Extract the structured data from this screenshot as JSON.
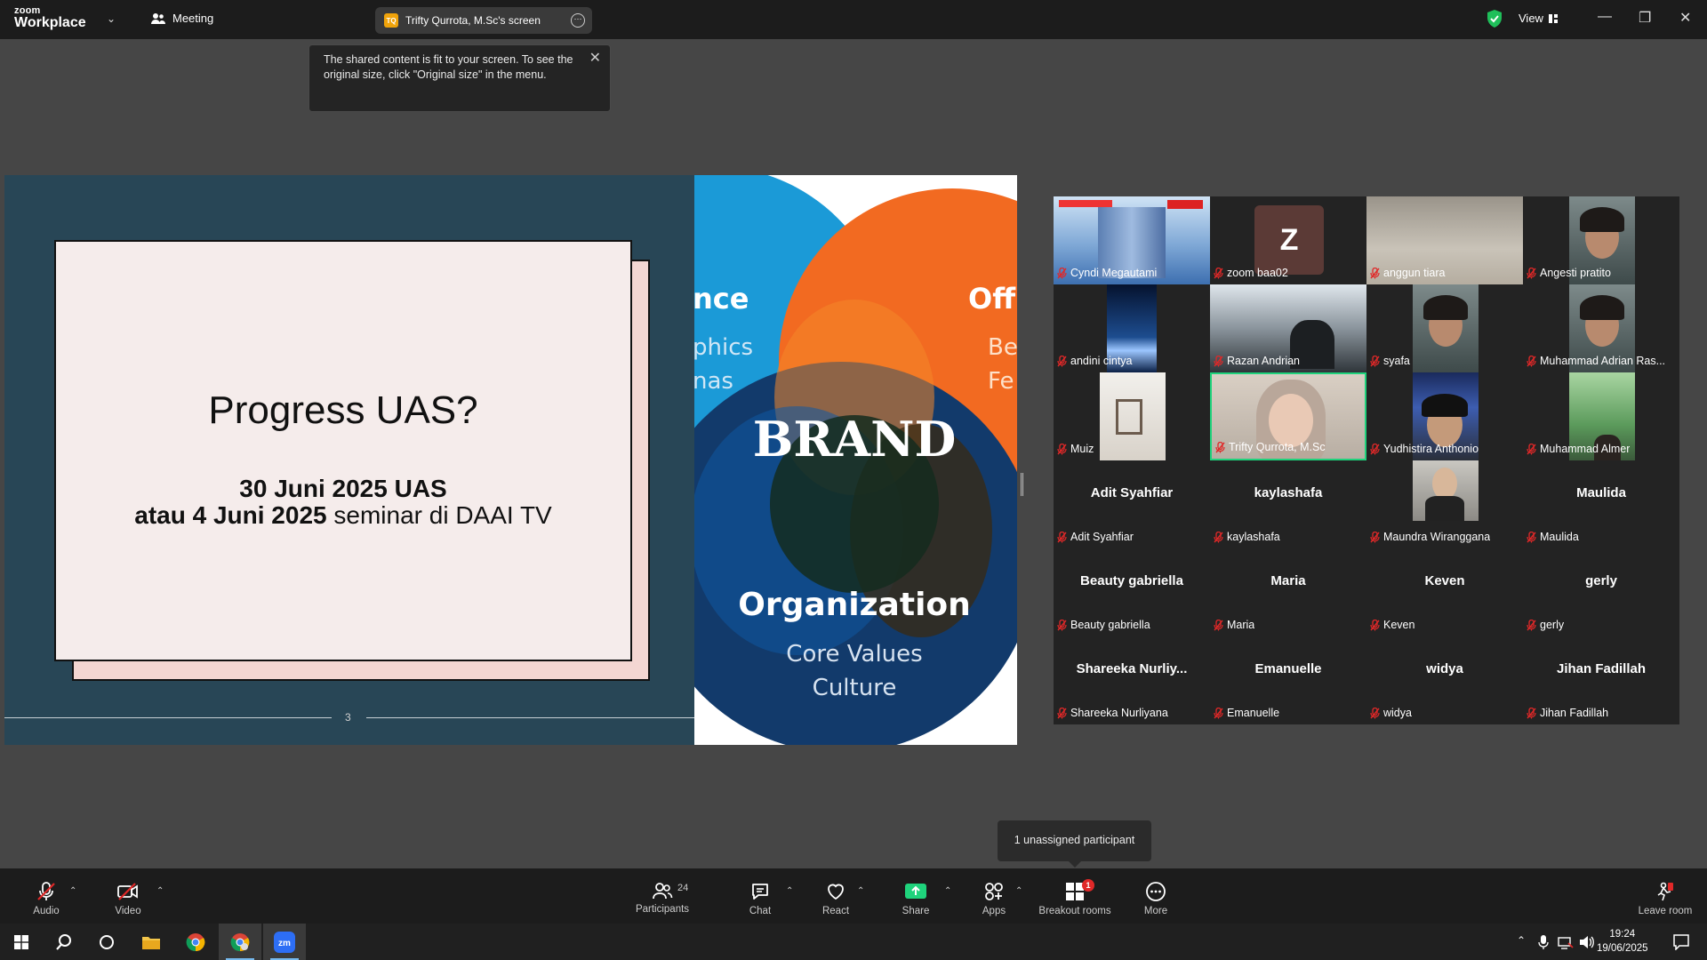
{
  "titlebar": {
    "logo_top": "zoom",
    "logo_bottom": "Workplace",
    "meeting_label": "Meeting",
    "share_tab_badge": "TQ",
    "share_tab_label": "Trifty Qurrota, M.Sc's screen",
    "view_label": "View"
  },
  "fit_tooltip": {
    "text": "The shared content is fit to your screen. To see the original size, click \"Original size\" in the menu."
  },
  "slide": {
    "title": "Progress UAS?",
    "line1": "30 Juni 2025 UAS",
    "line2_bold": "atau 4 Juni 2025",
    "line2_rest": " seminar di DAAI TV",
    "page_number": "3"
  },
  "brand_slide": {
    "left_word": "nce",
    "left_sub1": "phics",
    "left_sub2": "nas",
    "right_word": "Off",
    "right_sub1": "Be",
    "right_sub2": "Fe",
    "center": "BRAND",
    "bottom_title": "Organization",
    "bottom_sub1": "Core Values",
    "bottom_sub2": "Culture",
    "colors": {
      "blue": "#1a9ad6",
      "orange": "#f26a21",
      "navy": "#123a6b",
      "dark_blue": "#0e4f8c"
    }
  },
  "gallery": {
    "tiles": [
      {
        "label": "Cyndi Megautami",
        "center": "",
        "video": "building"
      },
      {
        "label": "zoom baa02",
        "center": "",
        "video": "avatar-z"
      },
      {
        "label": "anggun tiara",
        "center": "",
        "video": "blur"
      },
      {
        "label": "Angesti pratito",
        "center": "",
        "video": "face"
      },
      {
        "label": "andini cintya",
        "center": "",
        "video": "earth"
      },
      {
        "label": "Razan Andrian",
        "center": "",
        "video": "room"
      },
      {
        "label": "syafa",
        "center": "",
        "video": "face"
      },
      {
        "label": "Muhammad Adrian Ras...",
        "center": "",
        "video": "face"
      },
      {
        "label": "Muiz",
        "center": "",
        "video": "room-light"
      },
      {
        "label": "Trifty Qurrota, M.Sc",
        "center": "",
        "video": "speaker"
      },
      {
        "label": "Yudhistira Anthonio",
        "center": "",
        "video": "face-dark"
      },
      {
        "label": "Muhammad Almer",
        "center": "",
        "video": "green"
      },
      {
        "label": "Adit Syahfiar",
        "center": "Adit Syahfiar",
        "video": ""
      },
      {
        "label": "kaylashafa",
        "center": "kaylashafa",
        "video": ""
      },
      {
        "label": "Maundra Wiranggana",
        "center": "",
        "video": "person"
      },
      {
        "label": "Maulida",
        "center": "Maulida",
        "video": ""
      },
      {
        "label": "Beauty gabriella",
        "center": "Beauty gabriella",
        "video": ""
      },
      {
        "label": "Maria",
        "center": "Maria",
        "video": ""
      },
      {
        "label": "Keven",
        "center": "Keven",
        "video": ""
      },
      {
        "label": "gerly",
        "center": "gerly",
        "video": ""
      },
      {
        "label": "Shareeka Nurliyana",
        "center": "Shareeka  Nurliy...",
        "video": ""
      },
      {
        "label": "Emanuelle",
        "center": "Emanuelle",
        "video": ""
      },
      {
        "label": "widya",
        "center": "widya",
        "video": ""
      },
      {
        "label": "Jihan Fadillah",
        "center": "Jihan Fadillah",
        "video": ""
      }
    ],
    "avatar_letter": "Z"
  },
  "breakout_tooltip": "1 unassigned participant",
  "toolbar": {
    "audio": "Audio",
    "video": "Video",
    "participants": "Participants",
    "participants_count": "24",
    "chat": "Chat",
    "react": "React",
    "share": "Share",
    "apps": "Apps",
    "breakout": "Breakout rooms",
    "breakout_badge": "1",
    "more": "More",
    "leave": "Leave room"
  },
  "taskbar": {
    "time": "19:24",
    "date": "19/06/2025"
  }
}
